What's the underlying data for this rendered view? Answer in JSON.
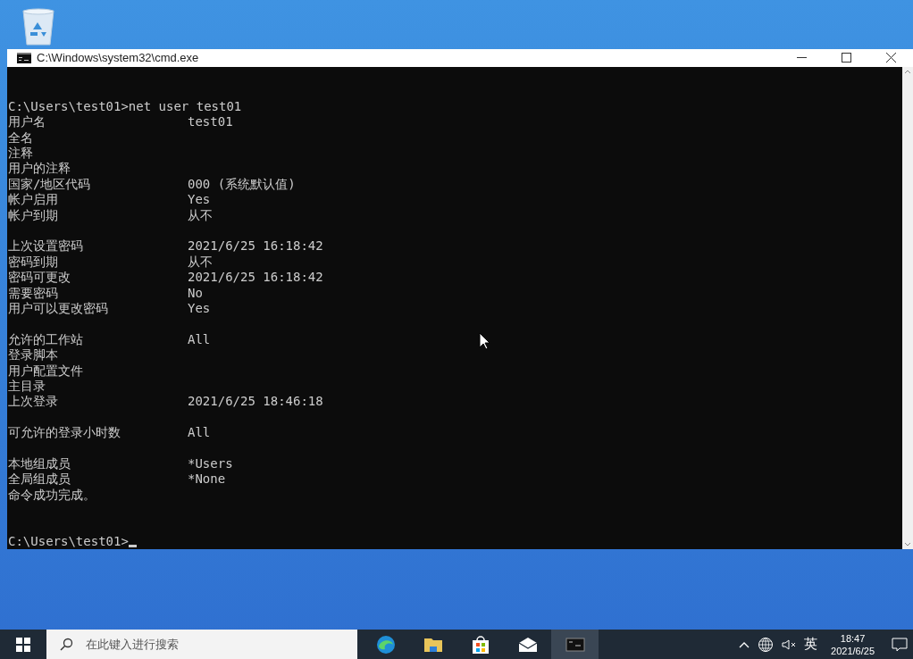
{
  "window": {
    "title": "C:\\Windows\\system32\\cmd.exe"
  },
  "console": {
    "lines": [
      {
        "kind": "blank"
      },
      {
        "kind": "command",
        "text": "C:\\Users\\test01>net user test01"
      },
      {
        "kind": "field",
        "label": "用户名",
        "value": "test01"
      },
      {
        "kind": "field",
        "label": "全名"
      },
      {
        "kind": "field",
        "label": "注释"
      },
      {
        "kind": "field",
        "label": "用户的注释"
      },
      {
        "kind": "field",
        "label": "国家/地区代码",
        "value": "000 (系统默认值)"
      },
      {
        "kind": "field",
        "label": "帐户启用",
        "value": "Yes"
      },
      {
        "kind": "field",
        "label": "帐户到期",
        "value": "从不"
      },
      {
        "kind": "blank"
      },
      {
        "kind": "field",
        "label": "上次设置密码",
        "value": "2021/6/25 16:18:42"
      },
      {
        "kind": "field",
        "label": "密码到期",
        "value": "从不"
      },
      {
        "kind": "field",
        "label": "密码可更改",
        "value": "2021/6/25 16:18:42"
      },
      {
        "kind": "field",
        "label": "需要密码",
        "value": "No"
      },
      {
        "kind": "field",
        "label": "用户可以更改密码",
        "value": "Yes"
      },
      {
        "kind": "blank"
      },
      {
        "kind": "field",
        "label": "允许的工作站",
        "value": "All"
      },
      {
        "kind": "field",
        "label": "登录脚本"
      },
      {
        "kind": "field",
        "label": "用户配置文件"
      },
      {
        "kind": "field",
        "label": "主目录"
      },
      {
        "kind": "field",
        "label": "上次登录",
        "value": "2021/6/25 18:46:18"
      },
      {
        "kind": "blank"
      },
      {
        "kind": "field",
        "label": "可允许的登录小时数",
        "value": "All"
      },
      {
        "kind": "blank"
      },
      {
        "kind": "field",
        "label": "本地组成员",
        "value": "*Users"
      },
      {
        "kind": "field",
        "label": "全局组成员",
        "value": "*None"
      },
      {
        "kind": "command",
        "text": "命令成功完成。"
      },
      {
        "kind": "blank"
      },
      {
        "kind": "blank"
      },
      {
        "kind": "prompt",
        "text": "C:\\Users\\test01>"
      }
    ]
  },
  "taskbar": {
    "search": {
      "placeholder": "在此键入进行搜索"
    },
    "apps": [
      {
        "kind": "edge",
        "selected": false
      },
      {
        "kind": "folder",
        "selected": false
      },
      {
        "kind": "store",
        "selected": false
      },
      {
        "kind": "mail",
        "selected": false
      },
      {
        "kind": "terminal",
        "selected": true
      }
    ],
    "tray": {
      "input_method": "英",
      "time": "18:47",
      "date": "2021/6/25"
    }
  }
}
